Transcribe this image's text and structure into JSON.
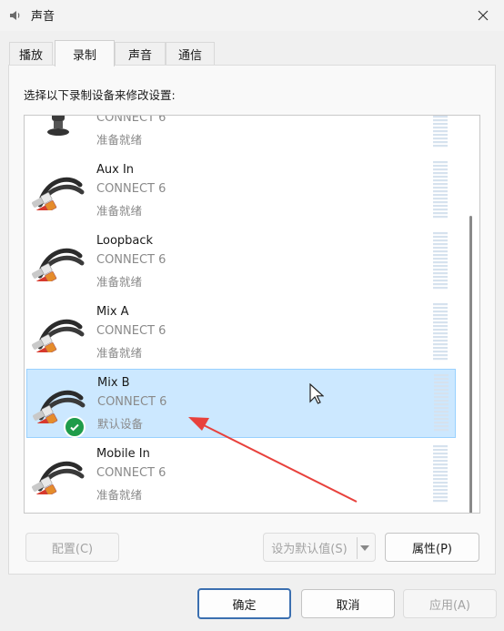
{
  "window": {
    "title": "声音",
    "title_icon": "speaker-icon"
  },
  "tabs": [
    {
      "label": "播放",
      "active": false
    },
    {
      "label": "录制",
      "active": true
    },
    {
      "label": "声音",
      "active": false
    },
    {
      "label": "通信",
      "active": false
    }
  ],
  "instruction": "选择以下录制设备来修改设置:",
  "devices": [
    {
      "name": "",
      "sub": "CONNECT 6",
      "status": "准备就绪",
      "icon": "microphone-icon",
      "selected": false,
      "default": false
    },
    {
      "name": "Aux In",
      "sub": "CONNECT 6",
      "status": "准备就绪",
      "icon": "rca-cable-icon",
      "selected": false,
      "default": false
    },
    {
      "name": "Loopback",
      "sub": "CONNECT 6",
      "status": "准备就绪",
      "icon": "rca-cable-icon",
      "selected": false,
      "default": false
    },
    {
      "name": "Mix A",
      "sub": "CONNECT 6",
      "status": "准备就绪",
      "icon": "rca-cable-icon",
      "selected": false,
      "default": false
    },
    {
      "name": "Mix B",
      "sub": "CONNECT 6",
      "status": "默认设备",
      "icon": "rca-cable-icon",
      "selected": true,
      "default": true
    },
    {
      "name": "Mobile In",
      "sub": "CONNECT 6",
      "status": "准备就绪",
      "icon": "rca-cable-icon",
      "selected": false,
      "default": false
    }
  ],
  "buttons": {
    "configure": "配置(C)",
    "set_default": "设为默认值(S)",
    "properties": "属性(P)",
    "ok": "确定",
    "cancel": "取消",
    "apply": "应用(A)"
  },
  "colors": {
    "selection": "#cce8ff",
    "default_badge": "#1f9c4a",
    "annotation_arrow": "#e8413c"
  }
}
